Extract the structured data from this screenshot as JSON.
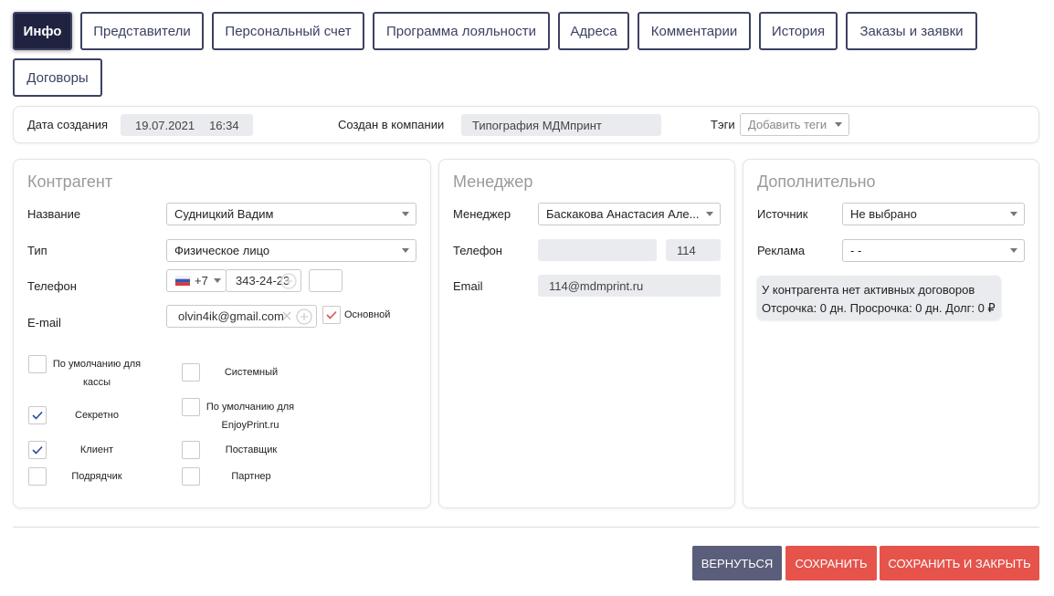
{
  "tabs": [
    "Инфо",
    "Представители",
    "Персональный счет",
    "Программа лояльности",
    "Адреса",
    "Комментарии",
    "История",
    "Заказы и заявки",
    "Договоры"
  ],
  "info_bar": {
    "created_label": "Дата создания",
    "created_date": "19.07.2021",
    "created_time": "16:34",
    "company_label": "Создан в компании",
    "company_value": "Типография МДМпринт",
    "tags_label": "Тэги",
    "tags_placeholder": "Добавить теги"
  },
  "contractor": {
    "title": "Контрагент",
    "name_label": "Название",
    "name_value": "Судницкий Вадим",
    "type_label": "Тип",
    "type_value": "Физическое лицо",
    "phone_label": "Телефон",
    "phone_code": "+7",
    "phone_number": "343-24-23",
    "phone_ext": "",
    "email_label": "E-mail",
    "email_value": "olvin4ik@gmail.com",
    "email_primary_label": "Основной",
    "flags": {
      "default_cash": "По умолчанию для кассы",
      "system": "Системный",
      "secret": "Секретно",
      "default_enjoyprint": "По умолчанию для EnjoyPrint.ru",
      "client": "Клиент",
      "supplier": "Поставщик",
      "contractor": "Подрядчик",
      "partner": "Партнер"
    }
  },
  "manager": {
    "title": "Менеджер",
    "manager_label": "Менеджер",
    "manager_value": "Баскакова Анастасия Але...",
    "phone_label": "Телефон",
    "phone_value": "",
    "phone_ext": "114",
    "email_label": "Email",
    "email_value": "114@mdmprint.ru"
  },
  "additional": {
    "title": "Дополнительно",
    "source_label": "Источник",
    "source_value": "Не выбрано",
    "ads_label": "Реклама",
    "ads_value": "- -",
    "contracts_line1": "У контрагента нет активных договоров",
    "contracts_line2": "Отсрочка: 0 дн. Просрочка: 0 дн. Долг: 0 ₽"
  },
  "buttons": {
    "back": "ВЕРНУТЬСЯ",
    "save": "СОХРАНИТЬ",
    "save_close": "СОХРАНИТЬ И ЗАКРЫТЬ"
  },
  "colors": {
    "tab_active": "#1f2340",
    "tab_border": "#3c4162",
    "btn_back": "#5a5e7a",
    "btn_save": "#e5534b"
  }
}
